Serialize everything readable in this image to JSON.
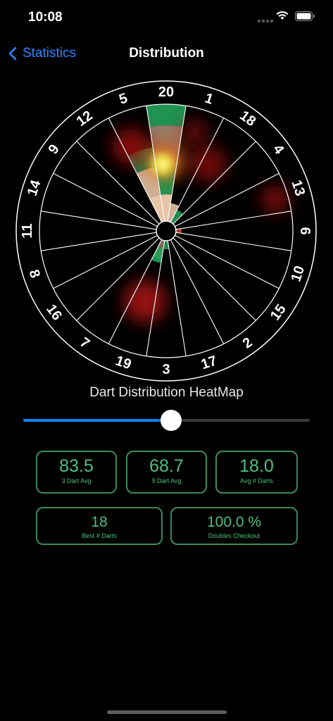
{
  "status_bar": {
    "time": "10:08"
  },
  "nav": {
    "back_label": "Statistics",
    "title": "Distribution"
  },
  "dartboard": {
    "numbers": [
      20,
      1,
      18,
      4,
      13,
      6,
      10,
      15,
      2,
      17,
      3,
      19,
      7,
      16,
      8,
      11,
      14,
      9,
      12,
      5
    ]
  },
  "heatmap": {
    "caption": "Dart Distribution HeatMap",
    "slider_value": 0.515
  },
  "stats": [
    {
      "value": "83.5",
      "label": "3 Dart Avg"
    },
    {
      "value": "68.7",
      "label": "9 Dart Avg"
    },
    {
      "value": "18.0",
      "label": "Avg # Darts"
    },
    {
      "value": "18",
      "label": "Best # Darts"
    },
    {
      "value": "100.0 %",
      "label": "Doubles Checkout"
    }
  ],
  "colors": {
    "accent": "#0a84ff",
    "back_link": "#2f86ff",
    "stat_border": "#3a8a5a",
    "stat_text": "#4fbf7f",
    "segment_green": "#22a35a",
    "segment_tan": "#f5d0b0",
    "segment_red": "#c0392b"
  }
}
